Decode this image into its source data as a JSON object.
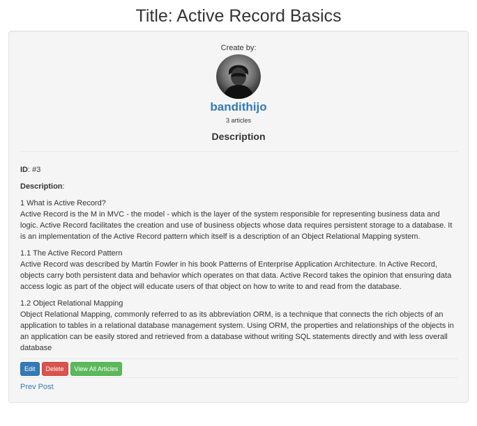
{
  "page": {
    "title": "Title: Active Record Basics"
  },
  "author": {
    "create_by_label": "Create by:",
    "name": "bandithijo",
    "article_count": "3 articles"
  },
  "description_heading": "Description",
  "fields": {
    "id_label": "ID",
    "id_value": ": #3",
    "description_label": "Description",
    "description_colon": ":"
  },
  "sections": [
    {
      "heading": "1 What is Active Record?",
      "body": "Active Record is the M in MVC - the model - which is the layer of the system responsible for representing business data and logic. Active Record facilitates the creation and use of business objects whose data requires persistent storage to a database. It is an implementation of the Active Record pattern which itself is a description of an Object Relational Mapping system."
    },
    {
      "heading": "1.1 The Active Record Pattern",
      "body": "Active Record was described by Martin Fowler in his book Patterns of Enterprise Application Architecture. In Active Record, objects carry both persistent data and behavior which operates on that data. Active Record takes the opinion that ensuring data access logic as part of the object will educate users of that object on how to write to and read from the database."
    },
    {
      "heading": "1.2 Object Relational Mapping",
      "body": "Object Relational Mapping, commonly referred to as its abbreviation ORM, is a technique that connects the rich objects of an application to tables in a relational database management system. Using ORM, the properties and relationships of the objects in an application can be easily stored and retrieved from a database without writing SQL statements directly and with less overall database"
    }
  ],
  "actions": {
    "edit_label": "Edit",
    "delete_label": "Delete",
    "view_all_label": "View All Articles"
  },
  "navigation": {
    "prev_label": "Prev Post"
  },
  "colors": {
    "link": "#337ab7",
    "primary": "#337ab7",
    "danger": "#d9534f",
    "success": "#5cb85c",
    "well_bg": "#f5f5f5"
  }
}
